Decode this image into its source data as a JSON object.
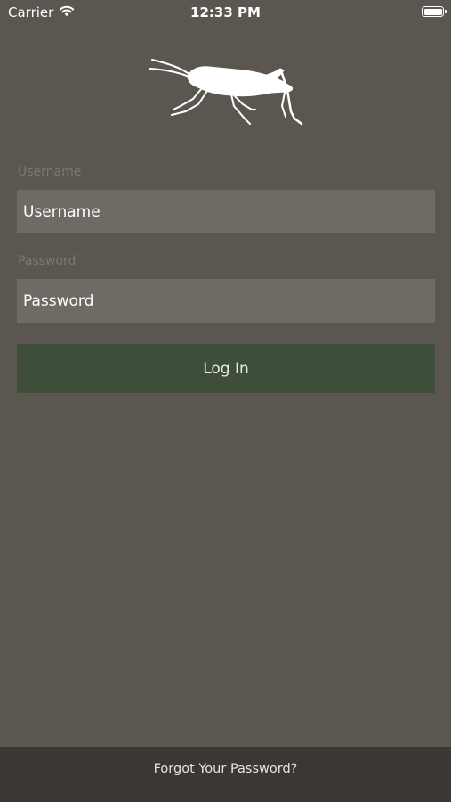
{
  "status_bar": {
    "carrier": "Carrier",
    "time": "12:33 PM"
  },
  "icons": {
    "wifi": "wifi-icon",
    "battery": "battery-icon",
    "logo": "cricket-logo"
  },
  "login_form": {
    "username_label": "Username",
    "username_placeholder": "Username",
    "password_label": "Password",
    "password_placeholder": "Password",
    "login_button": "Log In"
  },
  "footer": {
    "forgot_password": "Forgot Your Password?"
  },
  "colors": {
    "background": "#5b5750",
    "field_background": "#6f6b64",
    "button_background": "#3e4e3b",
    "footer_background": "#3b3834"
  }
}
